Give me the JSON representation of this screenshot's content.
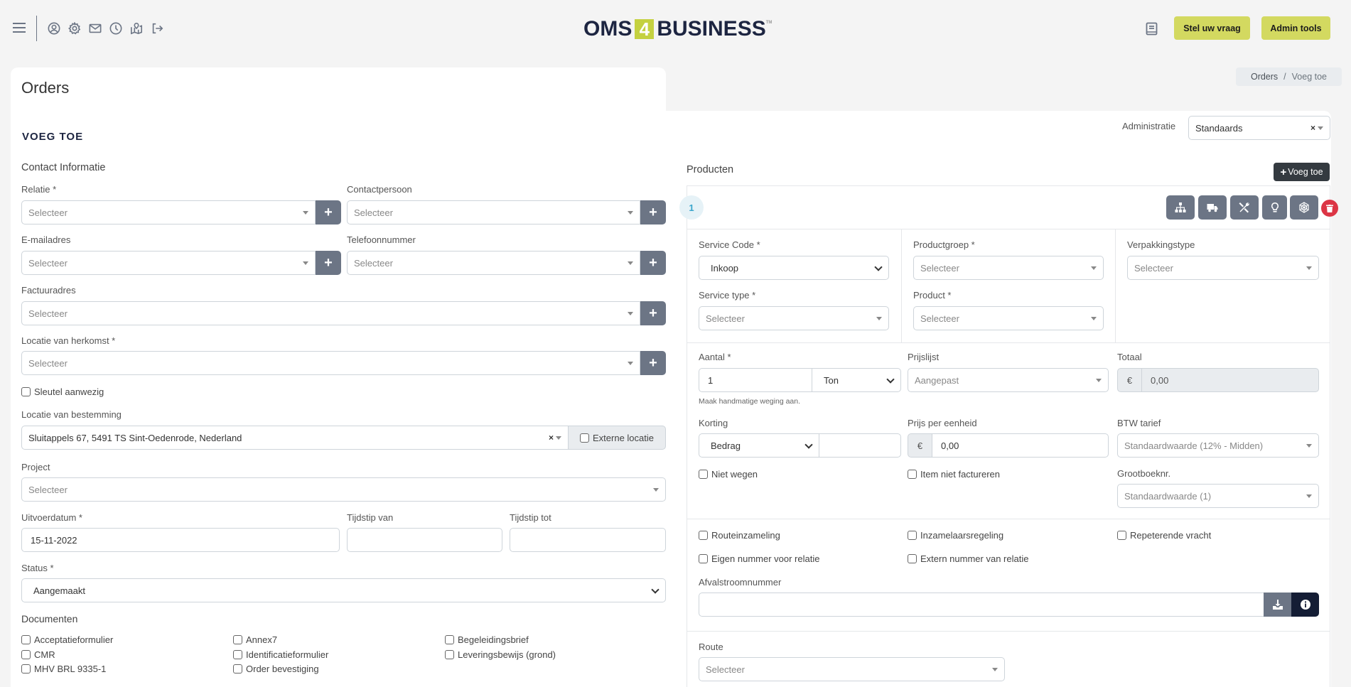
{
  "header": {
    "icons": [
      "menu-icon",
      "user-circle-icon",
      "gear-icon",
      "mail-icon",
      "clock-icon",
      "map-icon",
      "logout-icon"
    ],
    "logo": {
      "left": "OMS",
      "four": "4",
      "right": "BUSINESS",
      "tm": "TM"
    },
    "book_icon": "book-icon",
    "ask_button": "Stel uw vraag",
    "admin_button": "Admin tools",
    "accent_color": "#d3d960"
  },
  "breadcrumb": {
    "items": [
      "Orders",
      "Voeg toe"
    ],
    "separator": "/"
  },
  "page": {
    "title": "Orders",
    "section_title": "VOEG TOE"
  },
  "administratie": {
    "label": "Administratie",
    "value": "Standaards",
    "clear": "×"
  },
  "contact": {
    "heading": "Contact Informatie",
    "relatie": {
      "label": "Relatie *",
      "placeholder": "Selecteer"
    },
    "contactpersoon": {
      "label": "Contactpersoon",
      "placeholder": "Selecteer"
    },
    "email": {
      "label": "E-mailadres",
      "placeholder": "Selecteer"
    },
    "telefoon": {
      "label": "Telefoonnummer",
      "placeholder": "Selecteer"
    },
    "factuuradres": {
      "label": "Factuuradres",
      "placeholder": "Selecteer"
    },
    "herkomst": {
      "label": "Locatie van herkomst *",
      "placeholder": "Selecteer"
    },
    "sleutel": "Sleutel aanwezig",
    "bestemming": {
      "label": "Locatie van bestemming",
      "value": "Sluitappels 67, 5491 TS Sint-Oedenrode, Nederland",
      "clear": "×",
      "external": "Externe locatie"
    },
    "project": {
      "label": "Project",
      "placeholder": "Selecteer"
    },
    "uitvoerdatum": {
      "label": "Uitvoerdatum *",
      "value": "15-11-2022"
    },
    "tijd_van": {
      "label": "Tijdstip van",
      "value": ""
    },
    "tijd_tot": {
      "label": "Tijdstip tot",
      "value": ""
    },
    "status": {
      "label": "Status *",
      "value": "Aangemaakt"
    },
    "plus": "+"
  },
  "documenten": {
    "heading": "Documenten",
    "items": [
      "Acceptatieformulier",
      "Annex7",
      "Begeleidingsbrief",
      "CMR",
      "Identificatieformulier",
      "Leveringsbewijs (grond)",
      "MHV BRL 9335-1",
      "Order bevestiging"
    ]
  },
  "producten": {
    "heading": "Producten",
    "add_button": "Voeg toe",
    "item_number": "1",
    "tool_icons": [
      "sitemap-icon",
      "truck-icon",
      "tools-icon",
      "lightbulb-icon",
      "spider-web-icon"
    ],
    "delete_icon": "trash-icon",
    "service_code": {
      "label": "Service Code *",
      "value": "Inkoop"
    },
    "productgroep": {
      "label": "Productgroep *",
      "placeholder": "Selecteer"
    },
    "verpakkingstype": {
      "label": "Verpakkingstype",
      "placeholder": "Selecteer"
    },
    "service_type": {
      "label": "Service type *",
      "placeholder": "Selecteer"
    },
    "product": {
      "label": "Product *",
      "placeholder": "Selecteer"
    },
    "aantal": {
      "label": "Aantal *",
      "value": "1",
      "unit": "Ton",
      "help": "Maak handmatige weging aan."
    },
    "prijslijst": {
      "label": "Prijslijst",
      "value": "Aangepast"
    },
    "totaal": {
      "label": "Totaal",
      "currency": "€",
      "value": "0,00"
    },
    "korting": {
      "label": "Korting",
      "type": "Bedrag",
      "value": ""
    },
    "prijs_per_eenheid": {
      "label": "Prijs per eenheid",
      "currency": "€",
      "value": "0,00"
    },
    "btw": {
      "label": "BTW tarief",
      "value": "Standaardwaarde (12% - Midden)"
    },
    "niet_wegen": "Niet wegen",
    "item_niet_factureren": "Item niet factureren",
    "grootboek": {
      "label": "Grootboeknr.",
      "value": "Standaardwaarde (1)"
    },
    "routeinzameling": "Routeinzameling",
    "inzamelaarsregeling": "Inzamelaarsregeling",
    "repeterende_vracht": "Repeterende vracht",
    "eigen_nummer": "Eigen nummer voor relatie",
    "extern_nummer": "Extern nummer van relatie",
    "afvalstroom": {
      "label": "Afvalstroomnummer",
      "value": ""
    },
    "route": {
      "label": "Route",
      "placeholder": "Selecteer"
    }
  }
}
